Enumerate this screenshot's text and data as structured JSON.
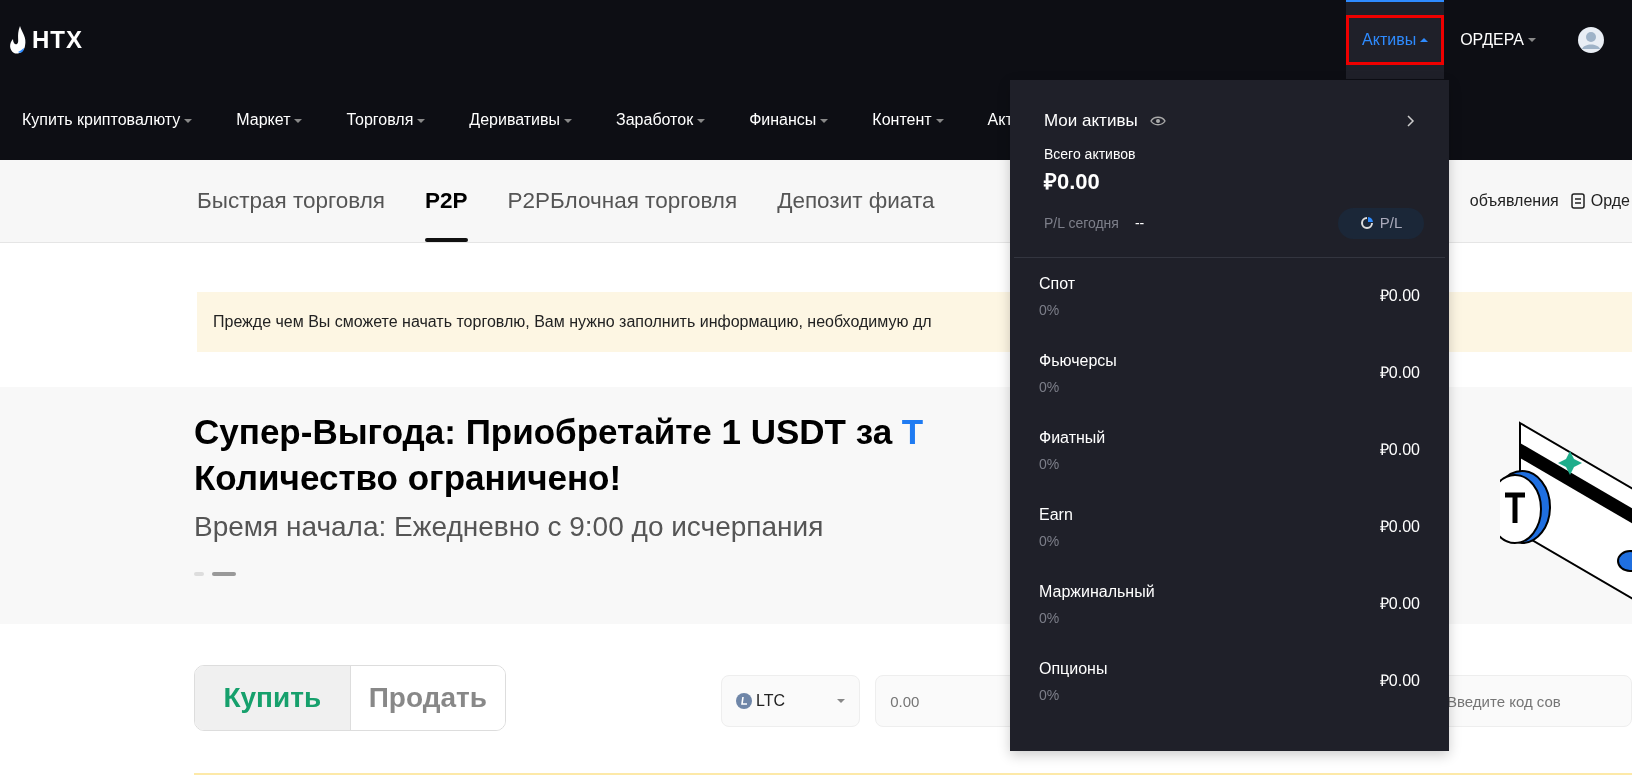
{
  "header": {
    "logo": "HTX",
    "menu": [
      {
        "label": "Активы",
        "selected": true,
        "highlighted": true
      },
      {
        "label": "ОРДЕРА",
        "selected": false,
        "highlighted": false
      }
    ]
  },
  "nav": [
    {
      "label": "Купить криптовалюту"
    },
    {
      "label": "Маркет"
    },
    {
      "label": "Торговля"
    },
    {
      "label": "Деривативы"
    },
    {
      "label": "Заработок"
    },
    {
      "label": "Финансы"
    },
    {
      "label": "Контент"
    },
    {
      "label": "Акт"
    }
  ],
  "tabs": [
    {
      "label": "Быстрая торговля",
      "selected": false
    },
    {
      "label": "P2P",
      "selected": true
    },
    {
      "label": "P2PБлочная торговля",
      "selected": false
    },
    {
      "label": "Депозит фиата",
      "selected": false
    }
  ],
  "tab_links": [
    {
      "label": "объявления"
    },
    {
      "label": "Орде"
    }
  ],
  "notice": "Прежде чем Вы сможете начать торговлю, Вам нужно заполнить информацию, необходимую дл",
  "banner": {
    "title_start": "Супер-Выгода: Приобретайте 1 USDT за",
    "title_highlight": "Т",
    "title_line2": "Количество ограничено!",
    "subtitle": "Время начала: Ежедневно с 9:00 до исчерпания",
    "slides": [
      {
        "selected": false
      },
      {
        "selected": true
      }
    ]
  },
  "trade": {
    "sides": [
      {
        "label": "Купить",
        "selected": true
      },
      {
        "label": "Продать",
        "selected": false
      }
    ],
    "coin": "LTC",
    "amount": {
      "placeholder": "0.00"
    },
    "code": {
      "placeholder": "Введите код сов"
    }
  },
  "assets_menu": {
    "title": "Мои активы",
    "total_label": "Всего активов",
    "total": "₽0.00",
    "pl_label": "P/L сегодня",
    "pl_value": "--",
    "pl_button": "P/L",
    "accounts": [
      {
        "name": "Спот",
        "share": "0%",
        "value": "₽0.00"
      },
      {
        "name": "Фьючерсы",
        "share": "0%",
        "value": "₽0.00"
      },
      {
        "name": "Фиатный",
        "share": "0%",
        "value": "₽0.00"
      },
      {
        "name": "Earn",
        "share": "0%",
        "value": "₽0.00"
      },
      {
        "name": "Маржинальный",
        "share": "0%",
        "value": "₽0.00"
      },
      {
        "name": "Опционы",
        "share": "0%",
        "value": "₽0.00"
      }
    ]
  }
}
